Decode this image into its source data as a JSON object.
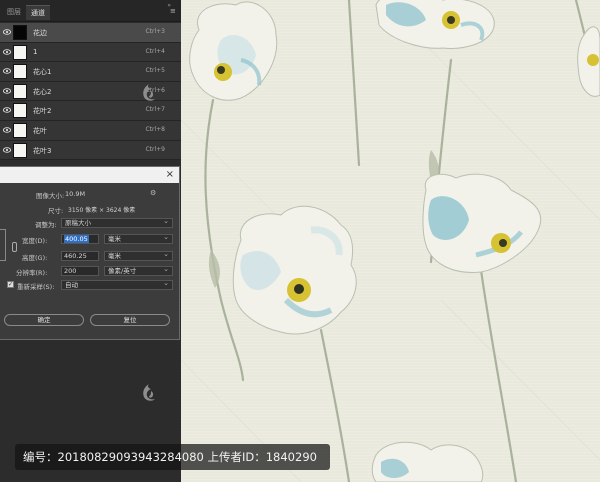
{
  "panel": {
    "tabs": [
      "图层",
      "通道"
    ],
    "active_tab": "通道",
    "channels": [
      {
        "name": "花边",
        "shortcut": "Ctrl+3",
        "thumb": "black"
      },
      {
        "name": "1",
        "shortcut": "Ctrl+4",
        "thumb": "white"
      },
      {
        "name": "花心1",
        "shortcut": "Ctrl+5",
        "thumb": "white"
      },
      {
        "name": "花心2",
        "shortcut": "Ctrl+6",
        "thumb": "white"
      },
      {
        "name": "花叶2",
        "shortcut": "Ctrl+7",
        "thumb": "white"
      },
      {
        "name": "花叶",
        "shortcut": "Ctrl+8",
        "thumb": "white"
      },
      {
        "name": "花叶3",
        "shortcut": "Ctrl+9",
        "thumb": "white"
      }
    ]
  },
  "dialog": {
    "image_size_label": "图像大小:",
    "image_size_value": "10.9M",
    "dimensions_label": "尺寸:",
    "dimensions_value": "3150 像素 × 3624 像素",
    "fit_to_label": "调整为:",
    "fit_to_value": "原稿大小",
    "width_label": "宽度(D):",
    "width_value": "400.05",
    "width_unit": "毫米",
    "height_label": "高度(G):",
    "height_value": "460.25",
    "height_unit": "毫米",
    "resolution_label": "分辨率(R):",
    "resolution_value": "200",
    "resolution_unit": "像素/英寸",
    "resample_label": "重新采样(S):",
    "resample_value": "自动",
    "ok_label": "确定",
    "reset_label": "复位",
    "close_glyph": "×"
  },
  "overlay": {
    "text": "编号：20180829093943284080 上传者ID：1840290"
  },
  "colors": {
    "canvas_bg": "#ecece0",
    "petal_blue": "#8fc3cf",
    "stem_green": "#a9b39c",
    "center_yellow": "#d6c232"
  }
}
